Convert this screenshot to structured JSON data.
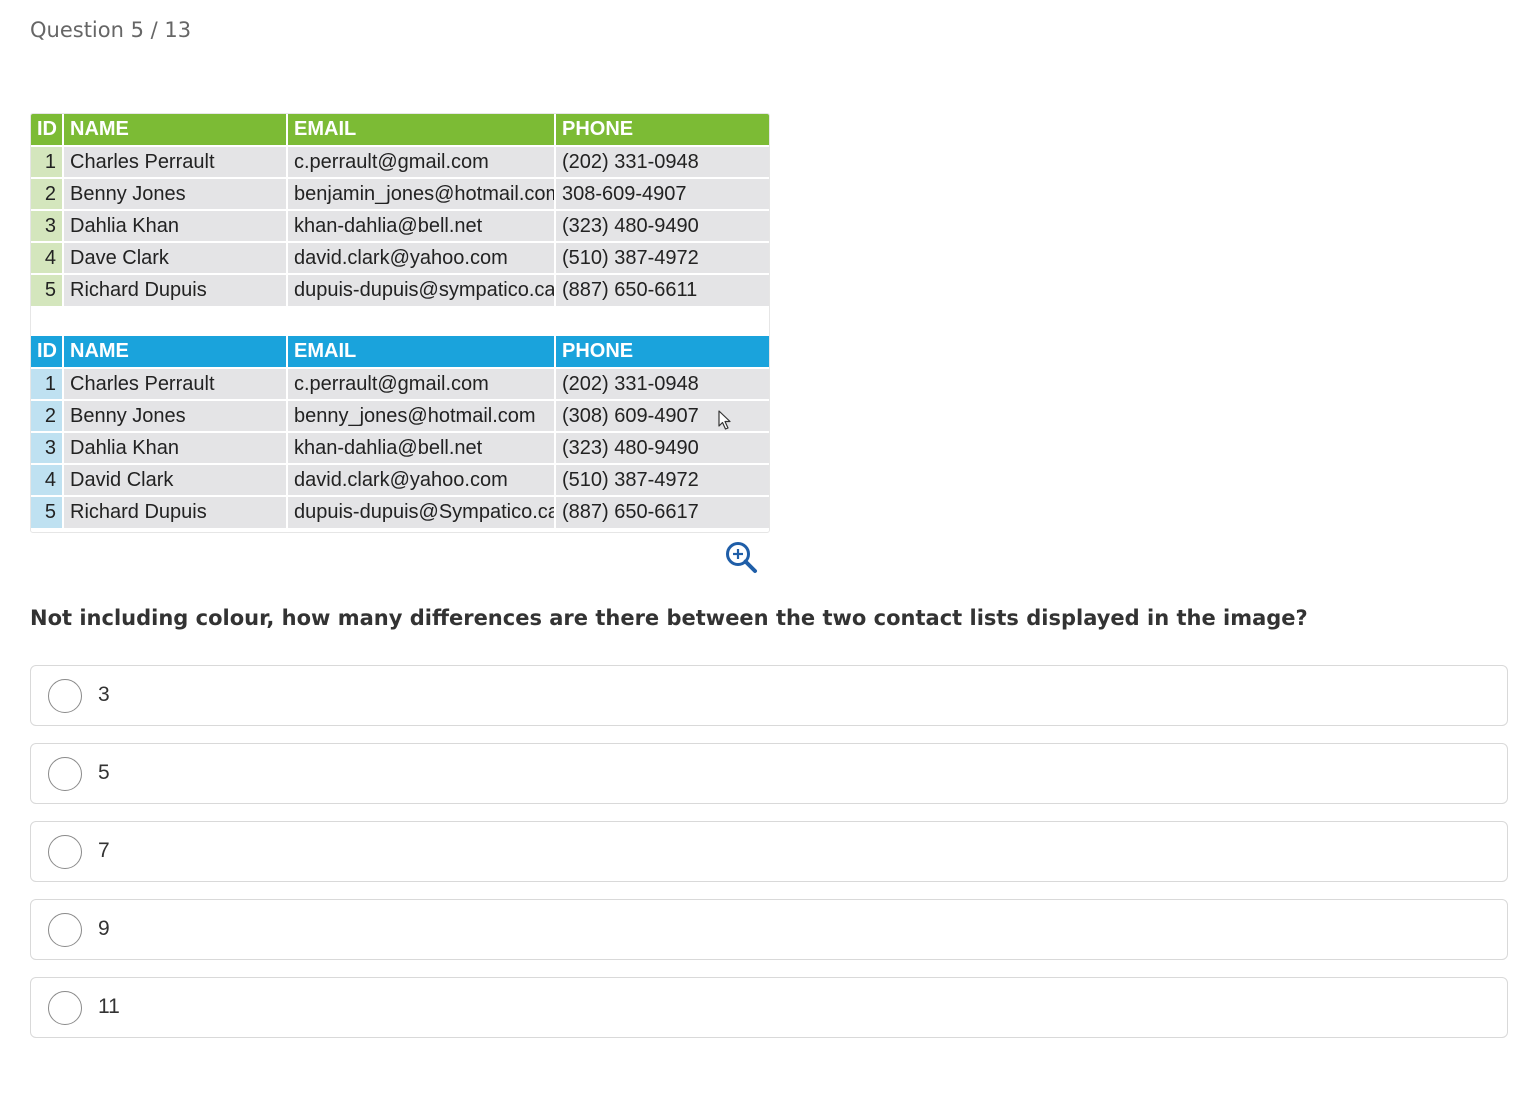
{
  "header": {
    "question_counter": "Question 5 / 13"
  },
  "figure": {
    "columns": [
      "ID",
      "NAME",
      "EMAIL",
      "PHONE"
    ],
    "table_a": {
      "header_color": "#7cbb35",
      "id_color": "#d4e6bd",
      "rows": [
        [
          "1",
          "Charles Perrault",
          "c.perrault@gmail.com",
          "(202) 331-0948"
        ],
        [
          "2",
          "Benny Jones",
          "benjamin_jones@hotmail.com",
          "308-609-4907"
        ],
        [
          "3",
          "Dahlia Khan",
          "khan-dahlia@bell.net",
          "(323) 480-9490"
        ],
        [
          "4",
          "Dave Clark",
          "david.clark@yahoo.com",
          "(510) 387-4972"
        ],
        [
          "5",
          "Richard Dupuis",
          "dupuis-dupuis@sympatico.ca",
          "(887) 650-6611"
        ]
      ]
    },
    "table_b": {
      "header_color": "#1aa3dc",
      "id_color": "#bfe1f1",
      "rows": [
        [
          "1",
          "Charles Perrault",
          "c.perrault@gmail.com",
          "(202) 331-0948"
        ],
        [
          "2",
          "Benny Jones",
          "benny_jones@hotmail.com",
          "(308) 609-4907"
        ],
        [
          "3",
          "Dahlia Khan",
          "khan-dahlia@bell.net",
          "(323) 480-9490"
        ],
        [
          "4",
          "David Clark",
          "david.clark@yahoo.com",
          "(510) 387-4972"
        ],
        [
          "5",
          "Richard Dupuis",
          "dupuis-dupuis@Sympatico.ca",
          "(887) 650-6617"
        ]
      ]
    },
    "zoom_icon": "zoom-in-icon",
    "zoom_color": "#1f5ea8"
  },
  "question": {
    "text": "Not including colour, how many differences are there between the two contact lists displayed in the image?"
  },
  "options": [
    {
      "label": "3"
    },
    {
      "label": "5"
    },
    {
      "label": "7"
    },
    {
      "label": "9"
    },
    {
      "label": "11"
    }
  ]
}
